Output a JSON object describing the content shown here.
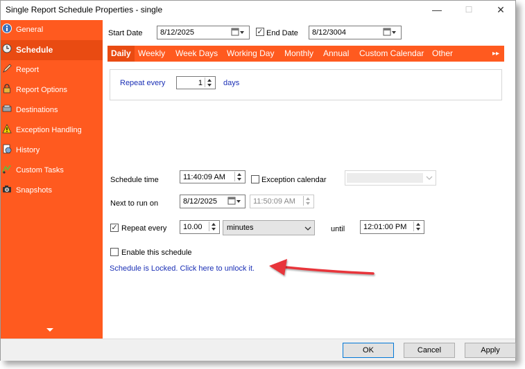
{
  "window": {
    "title": "Single Report Schedule Properties - single",
    "minimize": "—",
    "maximize": "☐",
    "close": "✕"
  },
  "sidebar": {
    "items": [
      {
        "label": "General",
        "icon": "info-icon"
      },
      {
        "label": "Schedule",
        "icon": "clock-icon",
        "active": true
      },
      {
        "label": "Report",
        "icon": "pen-icon"
      },
      {
        "label": "Report Options",
        "icon": "lock-icon"
      },
      {
        "label": "Destinations",
        "icon": "destinations-icon"
      },
      {
        "label": "Exception Handling",
        "icon": "warning-icon"
      },
      {
        "label": "History",
        "icon": "history-icon"
      },
      {
        "label": "Custom Tasks",
        "icon": "tasks-icon"
      },
      {
        "label": "Snapshots",
        "icon": "camera-icon"
      }
    ]
  },
  "dates": {
    "start_label": "Start Date",
    "start_value": "8/12/2025",
    "end_checked": "✓",
    "end_label": "End Date",
    "end_value": "8/12/3004"
  },
  "tabs": [
    "Daily",
    "Weekly",
    "Week Days",
    "Working Day",
    "Monthly",
    "Annual",
    "Custom Calendar",
    "Other"
  ],
  "tabs_more": "▸▸",
  "repeat_panel": {
    "label": "Repeat every",
    "value": "1",
    "unit": "days"
  },
  "schedule_time": {
    "label": "Schedule time",
    "value": "11:40:09 AM"
  },
  "exception_calendar": {
    "label": "Exception calendar",
    "value": ""
  },
  "next_run": {
    "label": "Next to run on",
    "date": "8/12/2025",
    "time": "11:50:09 AM"
  },
  "repeat": {
    "checked": "✓",
    "label": "Repeat every",
    "value": "10.00",
    "unit": "minutes",
    "until_label": "until",
    "until_value": "12:01:00 PM"
  },
  "enable": {
    "label": "Enable this schedule"
  },
  "unlock_link": "Schedule is Locked. Click here to unlock it.",
  "buttons": {
    "ok": "OK",
    "cancel": "Cancel",
    "apply": "Apply"
  },
  "colors": {
    "accent": "#ff5a1f",
    "accent_dark": "#e94b12",
    "annotation_arrow": "#e8353b",
    "link": "#1a2fb5"
  }
}
